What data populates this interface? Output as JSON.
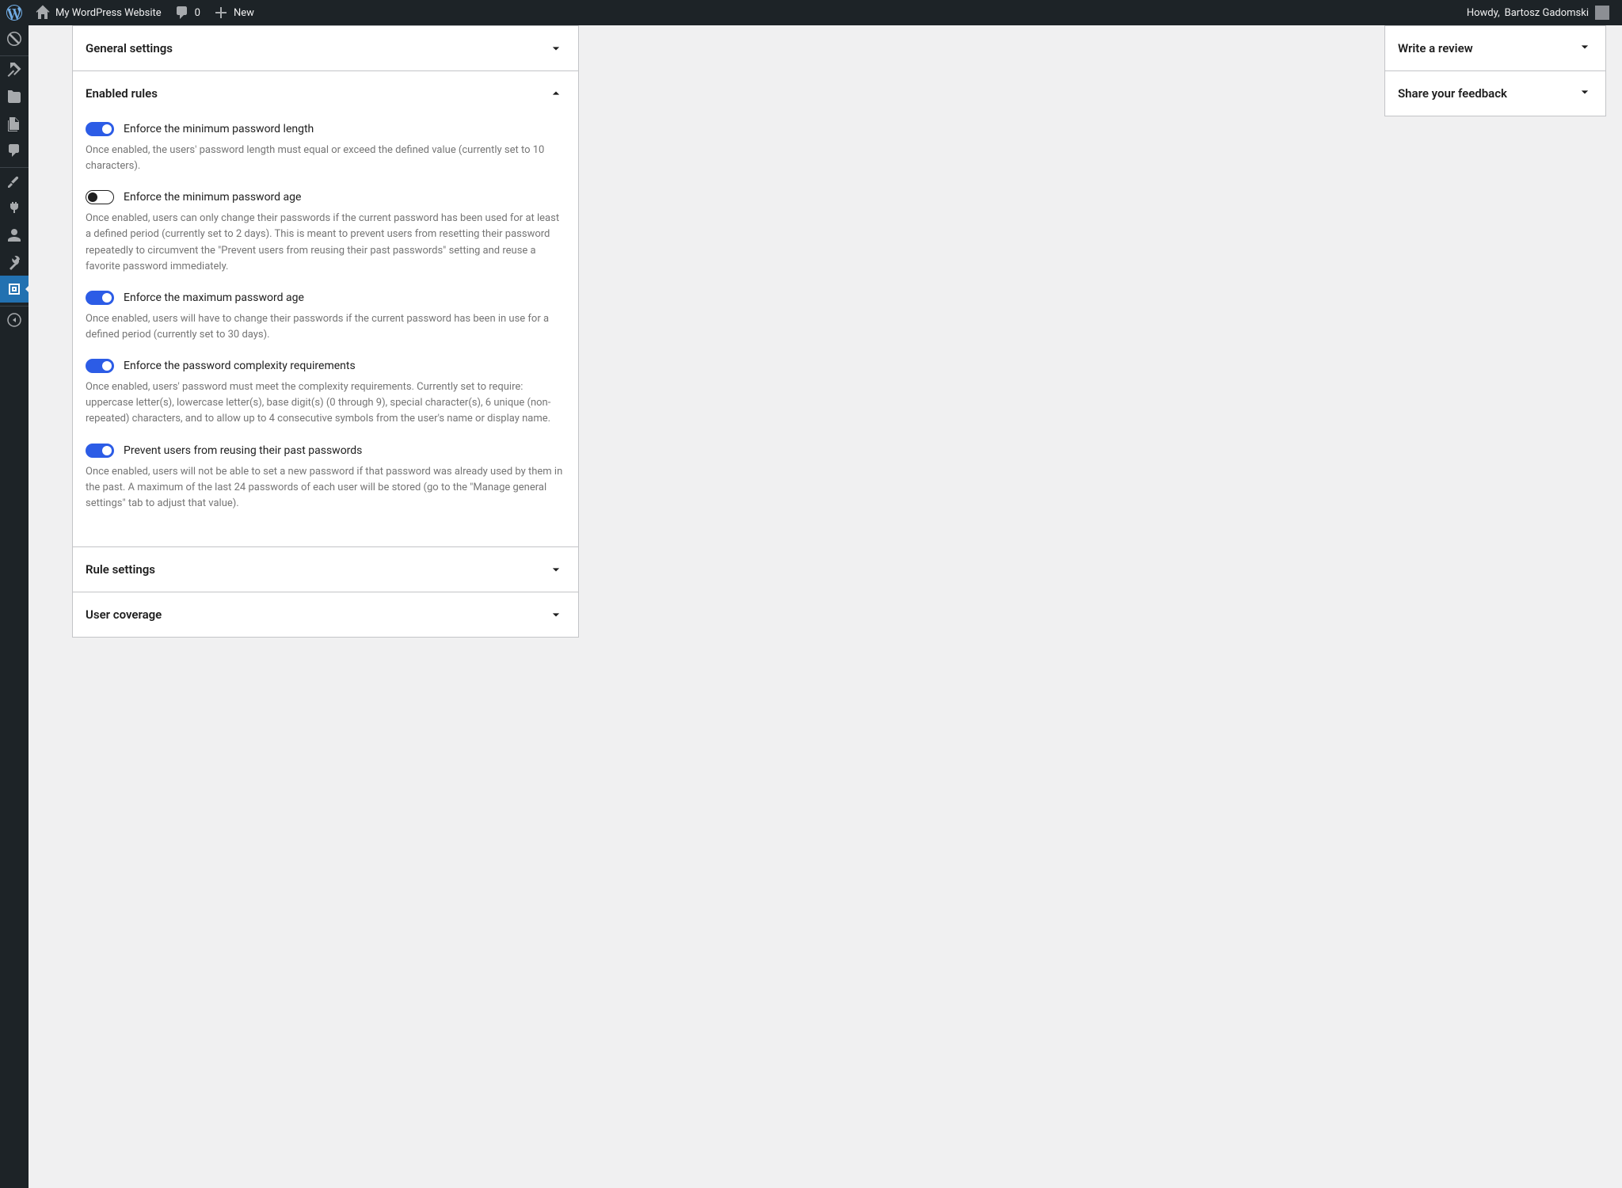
{
  "adminbar": {
    "site_title": "My WordPress Website",
    "comments_count": "0",
    "new_label": "New",
    "howdy_prefix": "Howdy, ",
    "user_name": "Bartosz Gadomski"
  },
  "panels": {
    "general_settings": {
      "title": "General settings",
      "expanded": false
    },
    "enabled_rules": {
      "title": "Enabled rules",
      "expanded": true
    },
    "rule_settings": {
      "title": "Rule settings",
      "expanded": false
    },
    "user_coverage": {
      "title": "User coverage",
      "expanded": false
    }
  },
  "rules": [
    {
      "label": "Enforce the minimum password length",
      "enabled": true,
      "desc": "Once enabled, the users' password length must equal or exceed the defined value (currently set to 10 characters)."
    },
    {
      "label": "Enforce the minimum password age",
      "enabled": false,
      "desc": "Once enabled, users can only change their passwords if the current password has been used for at least a defined period (currently set to 2 days). This is meant to prevent users from resetting their password repeatedly to circumvent the \"Prevent users from reusing their past passwords\" setting and reuse a favorite password immediately."
    },
    {
      "label": "Enforce the maximum password age",
      "enabled": true,
      "desc": "Once enabled, users will have to change their passwords if the current password has been in use for a defined period (currently set to 30 days)."
    },
    {
      "label": "Enforce the password complexity requirements",
      "enabled": true,
      "desc": "Once enabled, users' password must meet the complexity requirements. Currently set to require: uppercase letter(s), lowercase letter(s), base digit(s) (0 through 9), special character(s), 6 unique (non-repeated) characters, and to allow up to 4 consecutive symbols from the user's name or display name."
    },
    {
      "label": "Prevent users from reusing their past passwords",
      "enabled": true,
      "desc": "Once enabled, users will not be able to set a new password if that password was already used by them in the past. A maximum of the last 24 passwords of each user will be stored (go to the \"Manage general settings\" tab to adjust that value)."
    }
  ],
  "sidebar": {
    "write_review": "Write a review",
    "share_feedback": "Share your feedback"
  }
}
